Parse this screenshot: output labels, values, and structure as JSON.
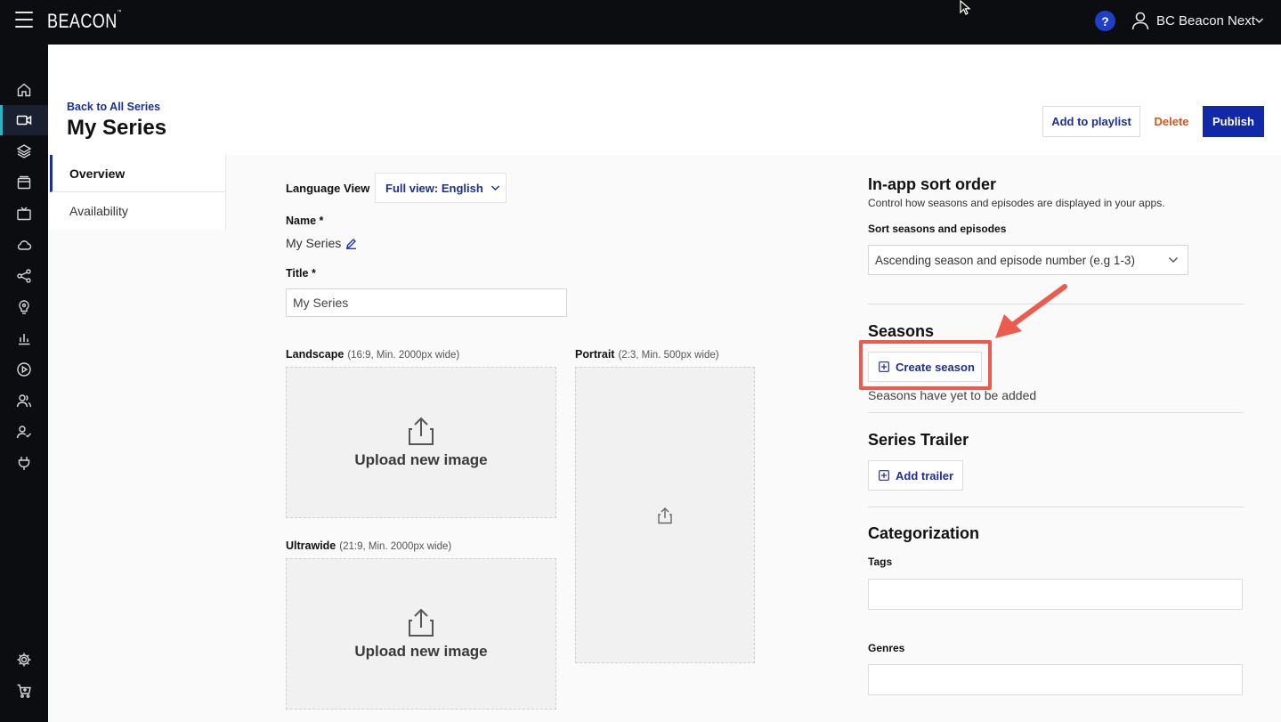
{
  "topbar": {
    "logo": "BEACON",
    "logo_mark": "™",
    "help_label": "?",
    "user_name": "BC Beacon Next"
  },
  "rail": {
    "icons": [
      "home-icon",
      "video-camera-icon",
      "layers-icon",
      "media-folder-icon",
      "tv-icon",
      "cloud-icon",
      "share-icon",
      "idea-icon",
      "analytics-icon",
      "play-circle-icon",
      "users-icon",
      "user-check-icon",
      "plug-icon",
      "settings-icon",
      "cart-icon"
    ],
    "active": "video-camera-icon"
  },
  "header": {
    "back_link": "Back to All Series",
    "title": "My Series",
    "add_to_playlist": "Add to playlist",
    "delete": "Delete",
    "publish": "Publish"
  },
  "tabs": [
    {
      "label": "Overview",
      "active": true
    },
    {
      "label": "Availability",
      "active": false
    }
  ],
  "form": {
    "language_label": "Language View",
    "language_value": "Full view: English",
    "name_label": "Name *",
    "name_value": "My Series",
    "title_label": "Title *",
    "title_value": "My Series",
    "landscape_label": "Landscape",
    "landscape_hint": "(16:9, Min. 2000px wide)",
    "portrait_label": "Portrait",
    "portrait_hint": "(2:3, Min. 500px wide)",
    "ultrawide_label": "Ultrawide",
    "ultrawide_hint": "(21:9, Min. 2000px wide)",
    "upload_text": "Upload new image"
  },
  "right": {
    "sort_title": "In-app sort order",
    "sort_desc": "Control how seasons and episodes are displayed in your apps.",
    "sort_label": "Sort seasons and episodes",
    "sort_value": "Ascending season and episode number (e.g 1-3)",
    "seasons_title": "Seasons",
    "create_season": "Create season",
    "seasons_empty": "Seasons have yet to be added",
    "trailer_title": "Series Trailer",
    "add_trailer": "Add trailer",
    "categorization_title": "Categorization",
    "tags_label": "Tags",
    "genres_label": "Genres"
  },
  "colors": {
    "topbar": "#0c0d10",
    "accent": "#1a2f99",
    "publish": "#1128a8",
    "delete": "#d9541b",
    "highlight": "#ec5b4d",
    "rail_active": "#2bb6c4"
  }
}
